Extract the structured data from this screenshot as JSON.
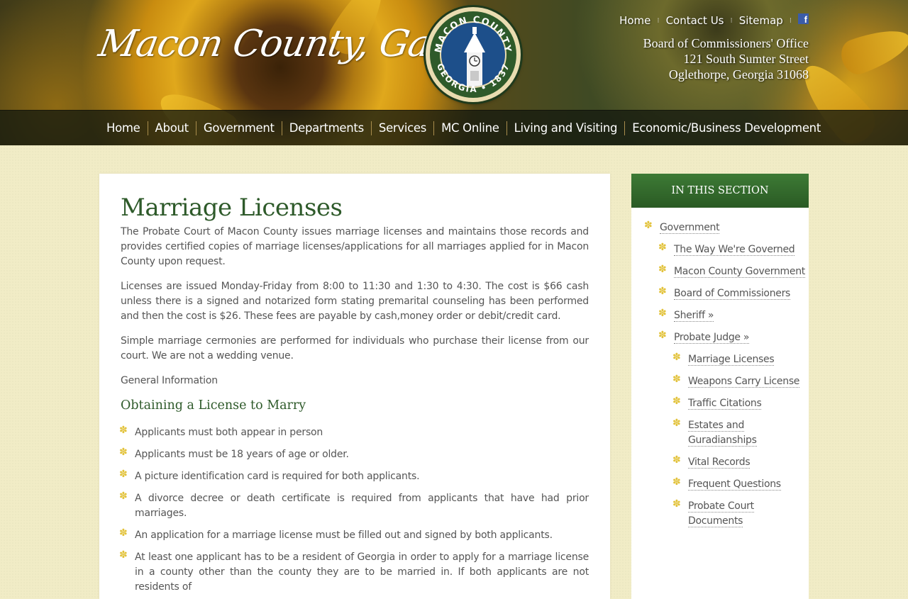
{
  "header": {
    "logo_text": "Macon County, Ga.",
    "seal": {
      "top_text": "MACON COUNTY",
      "bottom_text": "GEORGIA • 1837"
    },
    "top_links": [
      "Home",
      "Contact Us",
      "Sitemap"
    ],
    "social_icon": "facebook-icon",
    "address": {
      "line1": "Board of Commissioners' Office",
      "line2": "121 South Sumter Street",
      "line3": "Oglethorpe, Georgia 31068"
    }
  },
  "nav": {
    "items": [
      "Home",
      "About",
      "Government",
      "Departments",
      "Services",
      "MC Online",
      "Living and Visiting",
      "Economic/Business Development"
    ]
  },
  "main": {
    "title": "Marriage Licenses",
    "paragraphs": [
      "The Probate Court of Macon County issues marriage licenses and maintains those records and provides certified copies of marriage licenses/applications for all marriages applied for in Macon County upon request.",
      "Licenses are issued Monday-Friday from 8:00 to 11:30 and 1:30 to 4:30. The cost is $66 cash unless there is a signed and notarized form stating premarital counseling has been performed and then the cost is $26. These fees are payable by cash,money order or debit/credit card.",
      "Simple marriage cermonies are performed for individuals who purchase their license from our court. We are not a wedding venue.",
      "General Information"
    ],
    "section_heading": "Obtaining a License to Marry",
    "requirements": [
      "Applicants must both appear in person",
      "Applicants must be 18 years of age or older.",
      "A picture identification card is required for both applicants.",
      "A divorce decree or death certificate is required from applicants that have had prior marriages.",
      "An application for a marriage license must be filled out and signed by both applicants.",
      "At least one applicant has to be a resident of Georgia in order to apply for a marriage license in a county other than the county they are to be married in. If both applicants are not residents of"
    ],
    "bullet_icon": "asterisk-flower-icon"
  },
  "sidebar": {
    "header": "IN THIS SECTION",
    "items": [
      {
        "label": "Government",
        "level": 1
      },
      {
        "label": "The Way We're Governed",
        "level": 2
      },
      {
        "label": "Macon County Government",
        "level": 2
      },
      {
        "label": "Board of Commissioners",
        "level": 2
      },
      {
        "label": "Sheriff »",
        "level": 2
      },
      {
        "label": "Probate Judge »",
        "level": 2
      },
      {
        "label": "Marriage Licenses",
        "level": 3
      },
      {
        "label": "Weapons Carry License",
        "level": 3
      },
      {
        "label": "Traffic Citations",
        "level": 3
      },
      {
        "label": "Estates and Guradianships",
        "level": 3
      },
      {
        "label": "Vital Records",
        "level": 3
      },
      {
        "label": "Frequent Questions",
        "level": 3
      },
      {
        "label": "Probate Court Documents",
        "level": 3
      }
    ]
  },
  "colors": {
    "accent_green": "#2e5a2a",
    "bullet_yellow": "#e2c23a",
    "page_background": "#f1ecc6"
  }
}
